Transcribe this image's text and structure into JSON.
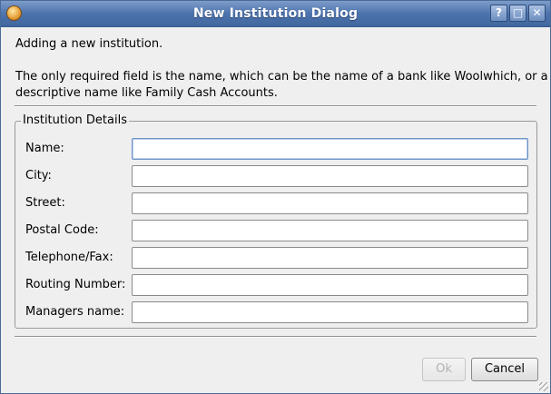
{
  "window": {
    "title": "New Institution Dialog",
    "buttons": [
      "?",
      "□",
      "✕"
    ]
  },
  "intro": {
    "line1": "Adding a new institution.",
    "line2": "The only required field is the name, which can be the name of a bank like Woolwhich, or a",
    "line3": "descriptive name like Family Cash Accounts."
  },
  "group": {
    "title": "Institution Details",
    "fields": [
      {
        "label": "Name:",
        "value": ""
      },
      {
        "label": "City:",
        "value": ""
      },
      {
        "label": "Street:",
        "value": ""
      },
      {
        "label": "Postal Code:",
        "value": ""
      },
      {
        "label": "Telephone/Fax:",
        "value": ""
      },
      {
        "label": "Routing Number:",
        "value": ""
      },
      {
        "label": "Managers name:",
        "value": ""
      }
    ]
  },
  "buttons": {
    "ok": "Ok",
    "cancel": "Cancel"
  }
}
